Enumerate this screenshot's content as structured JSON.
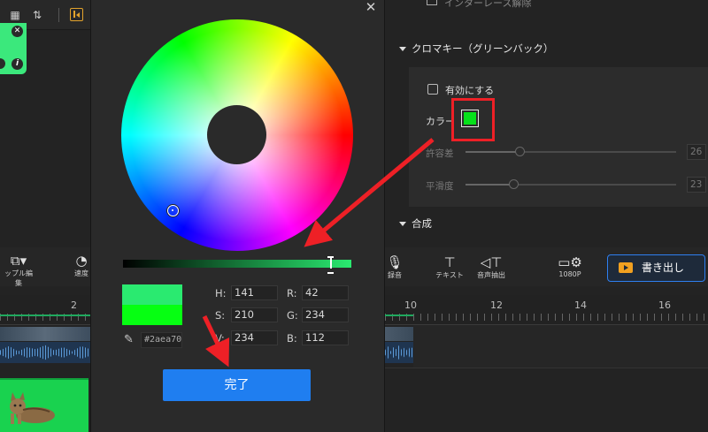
{
  "left_panel": {
    "ruler_label": "2",
    "toolbar": [
      {
        "label": "ップル編集",
        "icon": "split-icon"
      },
      {
        "label": "速度",
        "icon": "speed-icon"
      }
    ]
  },
  "right_panel": {
    "top_item": "インターレース解除",
    "chroma_section": "クロマキー（グリーンバック）",
    "enable_label": "有効にする",
    "color_label": "カラー",
    "swatch_color": "#06e11a",
    "tolerance_label": "許容差",
    "tolerance_value": "26",
    "smooth_label": "平滑度",
    "smooth_value": "23",
    "composite_section": "合成"
  },
  "bottom_toolbar": {
    "record_label": "録音",
    "text_label": "テキスト",
    "audio_extract_label": "音声抽出",
    "resolution_label": "1080P",
    "export_label": "書き出し"
  },
  "timeline": {
    "ticks": [
      "10",
      "12",
      "14",
      "16"
    ]
  },
  "color_picker": {
    "hex": "#2aea70",
    "new_color": "#2aea70",
    "old_color": "#06ff12",
    "h_label": "H:",
    "h_value": "141",
    "s_label": "S:",
    "s_value": "210",
    "v_label": "V:",
    "v_value": "234",
    "r_label": "R:",
    "r_value": "42",
    "g_label": "G:",
    "g_value": "234",
    "b_label": "B:",
    "b_value": "112",
    "done_label": "完了"
  },
  "annotation_color": "#ee2026"
}
